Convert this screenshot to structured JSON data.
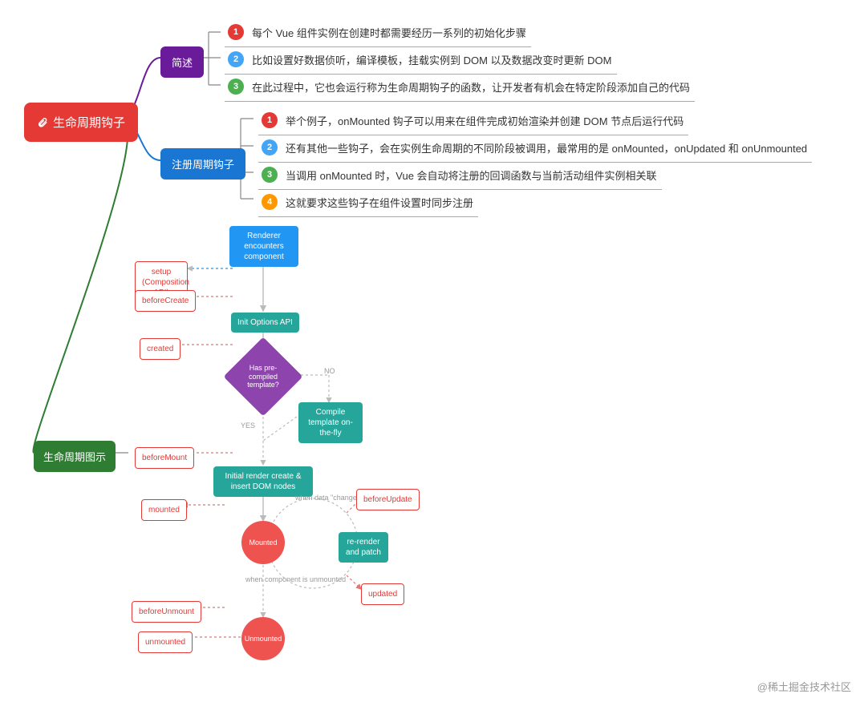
{
  "root": {
    "title": "生命周期钩子"
  },
  "section1": {
    "title": "简述",
    "items": [
      "每个 Vue 组件实例在创建时都需要经历一系列的初始化步骤",
      "比如设置好数据侦听，编译模板，挂载实例到 DOM 以及数据改变时更新 DOM",
      "在此过程中，它也会运行称为生命周期钩子的函数，让开发者有机会在特定阶段添加自己的代码"
    ]
  },
  "section2": {
    "title": "注册周期钩子",
    "items": [
      "举个例子，onMounted 钩子可以用来在组件完成初始渲染并创建 DOM 节点后运行代码",
      "还有其他一些钩子，会在实例生命周期的不同阶段被调用，最常用的是 onMounted，onUpdated 和 onUnmounted",
      "当调用 onMounted 时，Vue 会自动将注册的回调函数与当前活动组件实例相关联",
      "这就要求这些钩子在组件设置时同步注册"
    ]
  },
  "section3": {
    "title": "生命周期图示"
  },
  "flowchart": {
    "start": "Renderer\nencounters component",
    "setup": "setup\n(Composition API)",
    "beforeCreate": "beforeCreate",
    "initOptions": "Init Options API",
    "created": "created",
    "decision": "Has\npre-compiled\ntemplate?",
    "compile": "Compile template\non-the-fly",
    "yes": "YES",
    "no": "NO",
    "beforeMount": "beforeMount",
    "initialRender": "Initial render\ncreate & insert DOM nodes",
    "mounted_hook": "mounted",
    "mounted_state": "Mounted",
    "whenData": "when data\n\"changes\"",
    "beforeUpdate": "beforeUpdate",
    "rerender": "re-render\nand patch",
    "updated": "updated",
    "whenUnmount": "when\ncomponent\nis unmounted",
    "beforeUnmount": "beforeUnmount",
    "unmounted_hook": "unmounted",
    "unmounted_state": "Unmounted"
  },
  "watermark": "@稀土掘金技术社区",
  "chart_data": {
    "type": "mindmap+flowchart",
    "root": "生命周期钩子",
    "branches": [
      {
        "label": "简述",
        "children_count": 3
      },
      {
        "label": "注册周期钩子",
        "children_count": 4
      },
      {
        "label": "生命周期图示",
        "contains": "Vue lifecycle flowchart"
      }
    ],
    "lifecycle_order": [
      "Renderer encounters component",
      "setup (Composition API)",
      "beforeCreate",
      "Init Options API",
      "created",
      "Has pre-compiled template?",
      "Compile template on-the-fly",
      "beforeMount",
      "Initial render create & insert DOM nodes",
      "mounted",
      "Mounted",
      "beforeUpdate",
      "re-render and patch",
      "updated",
      "beforeUnmount",
      "Unmounted",
      "unmounted"
    ]
  }
}
